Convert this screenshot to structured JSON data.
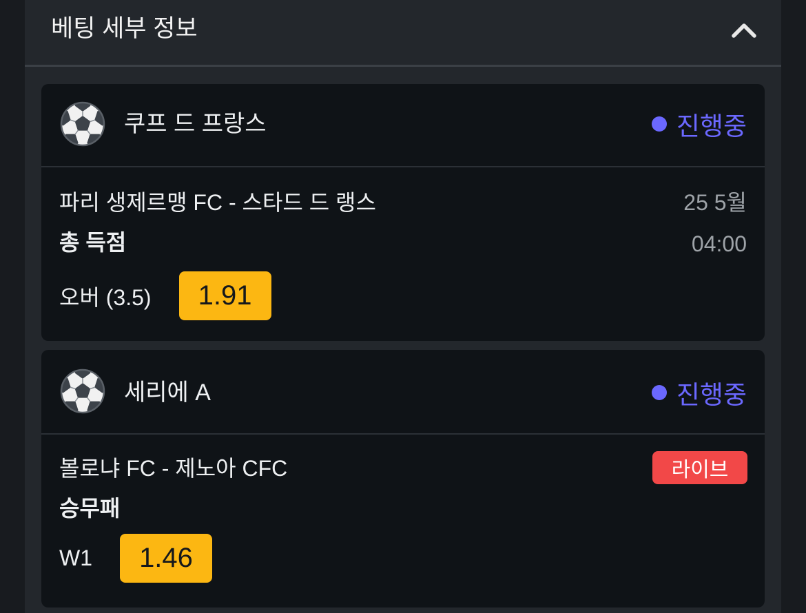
{
  "panel": {
    "title": "베팅 세부 정보",
    "toggle_icon": "chevron-up-icon"
  },
  "colors": {
    "page_background": "#181b1f",
    "panel_background": "#23272c",
    "card_background": "#0f1317",
    "status_in_progress": "#6b68ff",
    "odds_button": "#fcb712",
    "live_badge": "#f24848",
    "muted_text": "#9ea3a8"
  },
  "bets": [
    {
      "sport_icon": "soccer-ball-icon",
      "league": "쿠프 드 프랑스",
      "status": "진행중",
      "match": "파리 생제르맹 FC - 스타드 드 랭스",
      "date": "25 5월",
      "time": "04:00",
      "market": "총 득점",
      "selection": "오버 (3.5)",
      "odds": "1.91"
    },
    {
      "sport_icon": "soccer-ball-icon",
      "league": "세리에 A",
      "status": "진행중",
      "match": "볼로냐 FC - 제노아 CFC",
      "badge": "라이브",
      "market": "승무패",
      "selection": "W1",
      "odds": "1.46"
    }
  ]
}
